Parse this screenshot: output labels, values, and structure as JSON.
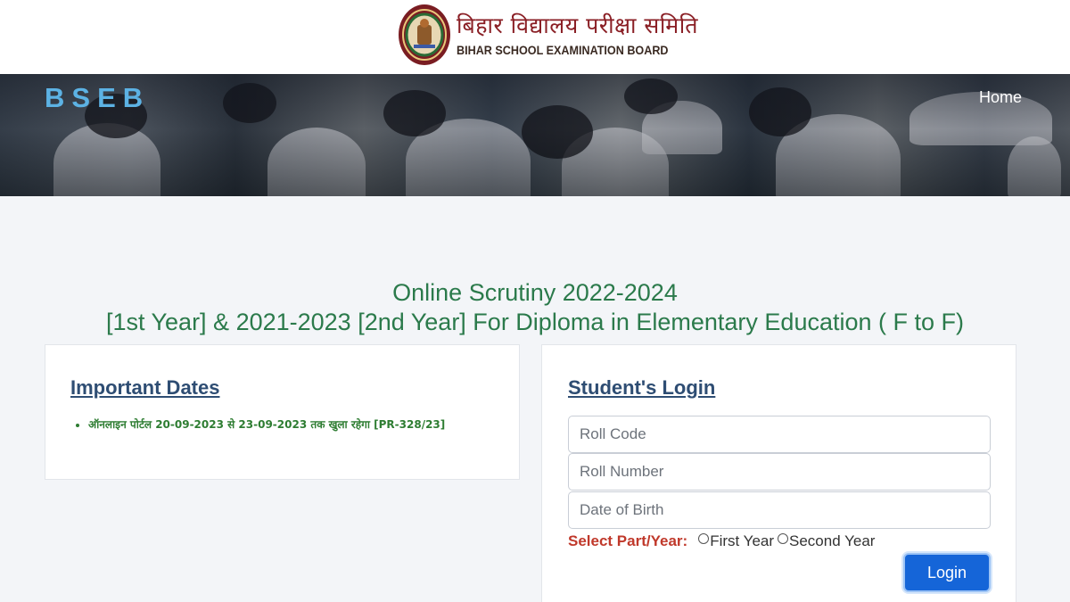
{
  "header": {
    "logo_hindi": "बिहार विद्यालय परीक्षा समिति",
    "logo_english": "BIHAR SCHOOL EXAMINATION BOARD"
  },
  "banner": {
    "brand": "BSEB",
    "nav_home": "Home"
  },
  "title": {
    "line1": "Online Scrutiny 2022-2024",
    "line2": "[1st Year] & 2021-2023 [2nd Year] For Diploma in Elementary Education ( F to F)"
  },
  "important_dates": {
    "heading": "Important Dates",
    "items": [
      "ऑनलाइन पोर्टल 20-09-2023 से 23-09-2023 तक खुला रहेगा [PR-328/23]"
    ]
  },
  "login": {
    "heading": "Student's Login",
    "roll_code_placeholder": "Roll Code",
    "roll_number_placeholder": "Roll Number",
    "dob_placeholder": "Date of Birth",
    "part_label": "Select Part/Year:",
    "options": [
      "First Year",
      "Second Year"
    ],
    "button": "Login"
  },
  "colors": {
    "brand": "#5cb2e4",
    "title_green": "#2b7a4b",
    "heading_blue": "#2e4d73",
    "part_label_red": "#c0392b",
    "button_blue": "#1565d8"
  }
}
